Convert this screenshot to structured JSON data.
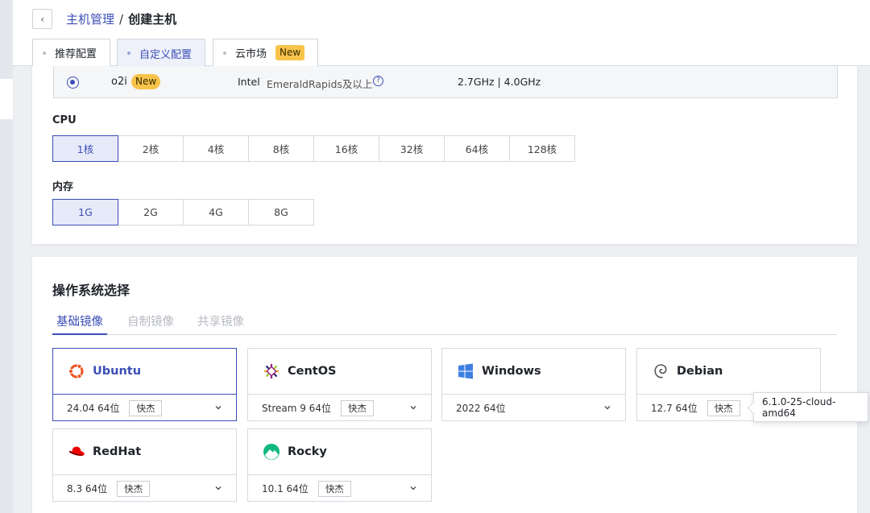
{
  "breadcrumb": {
    "parent": "主机管理",
    "separator": "/",
    "current": "创建主机"
  },
  "tabs": [
    {
      "label": "推荐配置"
    },
    {
      "label": "自定义配置"
    },
    {
      "label": "云市场",
      "badge": "New"
    }
  ],
  "instance_row": {
    "name": "o2i",
    "badge": "New",
    "brand": "Intel",
    "arch": "EmeraldRapids及以上",
    "freq": "2.7GHz | 4.0GHz"
  },
  "cpu": {
    "label": "CPU",
    "options": [
      "1核",
      "2核",
      "4核",
      "8核",
      "16核",
      "32核",
      "64核",
      "128核"
    ],
    "selected": "1核"
  },
  "memory": {
    "label": "内存",
    "options": [
      "1G",
      "2G",
      "4G",
      "8G"
    ],
    "selected": "1G"
  },
  "os_section": {
    "title": "操作系统选择",
    "tabs": [
      "基础镜像",
      "自制镜像",
      "共享镜像"
    ],
    "cards": [
      {
        "name": "Ubuntu",
        "icon": "ubuntu-icon",
        "version": "24.04 64位",
        "tag": "快杰",
        "selected": true
      },
      {
        "name": "CentOS",
        "icon": "centos-icon",
        "version": "Stream 9 64位",
        "tag": "快杰"
      },
      {
        "name": "Windows",
        "icon": "windows-icon",
        "version": "2022 64位"
      },
      {
        "name": "Debian",
        "icon": "debian-icon",
        "version": "12.7 64位",
        "tag": "快杰"
      },
      {
        "name": "RedHat",
        "icon": "redhat-icon",
        "version": "8.3 64位",
        "tag": "快杰"
      },
      {
        "name": "Rocky",
        "icon": "rocky-icon",
        "version": "10.1 64位",
        "tag": "快杰"
      }
    ],
    "tooltip": "6.1.0-25-cloud-amd64"
  },
  "colors": {
    "accent": "#3c4fb6",
    "badge": "#f7c34a"
  }
}
